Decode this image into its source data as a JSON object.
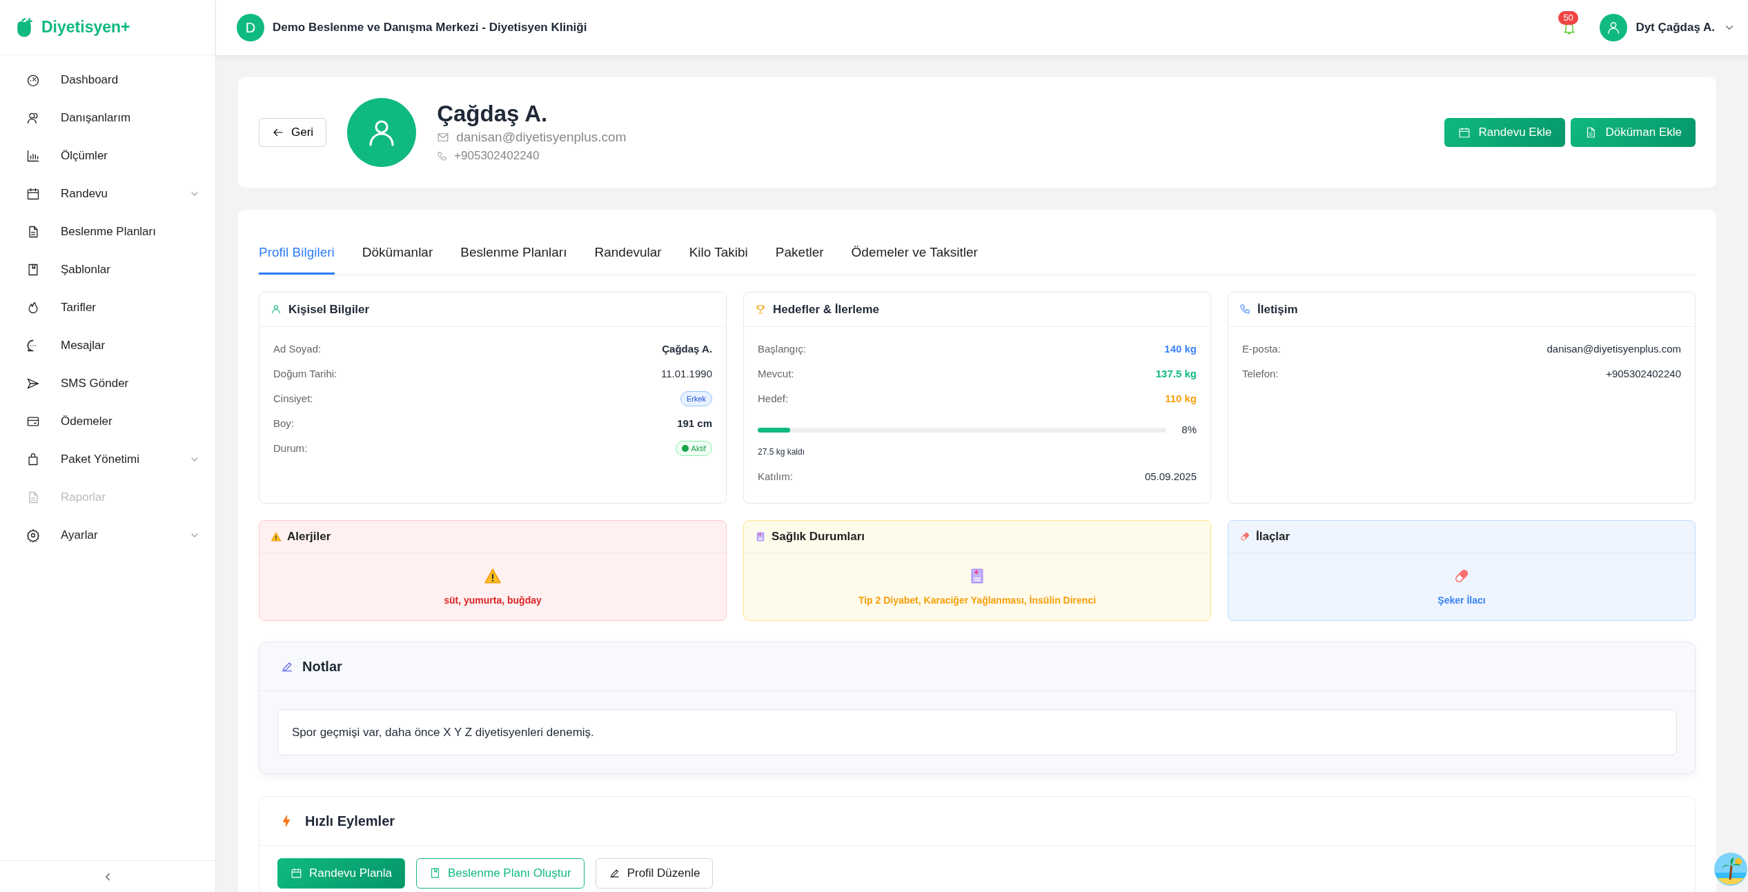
{
  "sidebar": {
    "brand": "Diyetisyen+",
    "items": [
      {
        "label": "Dashboard",
        "expandable": false,
        "disabled": false
      },
      {
        "label": "Danışanlarım",
        "expandable": false,
        "disabled": false
      },
      {
        "label": "Ölçümler",
        "expandable": false,
        "disabled": false
      },
      {
        "label": "Randevu",
        "expandable": true,
        "disabled": false
      },
      {
        "label": "Beslenme Planları",
        "expandable": false,
        "disabled": false
      },
      {
        "label": "Şablonlar",
        "expandable": false,
        "disabled": false
      },
      {
        "label": "Tarifler",
        "expandable": false,
        "disabled": false
      },
      {
        "label": "Mesajlar",
        "expandable": false,
        "disabled": false
      },
      {
        "label": "SMS Gönder",
        "expandable": false,
        "disabled": false
      },
      {
        "label": "Ödemeler",
        "expandable": false,
        "disabled": false
      },
      {
        "label": "Paket Yönetimi",
        "expandable": true,
        "disabled": false
      },
      {
        "label": "Raporlar",
        "expandable": false,
        "disabled": true
      },
      {
        "label": "Ayarlar",
        "expandable": true,
        "disabled": false
      }
    ]
  },
  "header": {
    "org_initial": "D",
    "org_title": "Demo Beslenme ve Danışma Merkezi - Diyetisyen Kliniği",
    "notification_count": "50",
    "user_name": "Dyt Çağdaş A."
  },
  "profile": {
    "back_label": "Geri",
    "name": "Çağdaş A.",
    "email": "danisan@diyetisyenplus.com",
    "phone": "+905302402240",
    "actions": [
      "Randevu Ekle",
      "Döküman Ekle"
    ]
  },
  "tabs": [
    {
      "label": "Profil Bilgileri",
      "selected": true
    },
    {
      "label": "Dökümanlar",
      "selected": false
    },
    {
      "label": "Beslenme Planları",
      "selected": false
    },
    {
      "label": "Randevular",
      "selected": false
    },
    {
      "label": "Kilo Takibi",
      "selected": false
    },
    {
      "label": "Paketler",
      "selected": false
    },
    {
      "label": "Ödemeler ve Taksitler",
      "selected": false
    }
  ],
  "personal": {
    "title": "Kişisel Bilgiler",
    "rows": [
      {
        "label": "Ad Soyad:",
        "value": "Çağdaş A.",
        "kind": "bold"
      },
      {
        "label": "Doğum Tarihi:",
        "value": "11.01.1990",
        "kind": "plain"
      },
      {
        "label": "Cinsiyet:",
        "value": "Erkek",
        "kind": "badge"
      },
      {
        "label": "Boy:",
        "value": "191 cm",
        "kind": "bold"
      },
      {
        "label": "Durum:",
        "value": "Aktif",
        "kind": "status"
      }
    ]
  },
  "goals": {
    "title": "Hedefler & İlerleme",
    "rows": [
      {
        "label": "Başlangıç:",
        "value": "140 kg",
        "color": "#3b82f6"
      },
      {
        "label": "Mevcut:",
        "value": "137.5 kg",
        "color": "#10b981"
      },
      {
        "label": "Hedef:",
        "value": "110 kg",
        "color": "#f59e0b"
      }
    ],
    "progress": {
      "level": 0.08,
      "reading": "8%",
      "remaining": "27.5 kg kaldı"
    },
    "joined": {
      "label": "Katılım:",
      "value": "05.09.2025"
    }
  },
  "contact": {
    "title": "İletişim",
    "rows": [
      {
        "label": "E-posta:",
        "value": "danisan@diyetisyenplus.com"
      },
      {
        "label": "Telefon:",
        "value": "+905302402240"
      }
    ]
  },
  "health": [
    {
      "kind": "allergy",
      "title": "Alerjiler",
      "text": "süt, yumurta, buğday"
    },
    {
      "kind": "condition",
      "title": "Sağlık Durumları",
      "text": "Tip 2 Diyabet, Karaciğer Yağlanması, İnsülin Direnci"
    },
    {
      "kind": "medication",
      "title": "İlaçlar",
      "text": "Şeker İlacı"
    }
  ],
  "notes": {
    "title": "Notlar",
    "text": "Spor geçmişi var, daha önce X Y Z diyetisyenleri denemiş."
  },
  "quick_actions": {
    "title": "Hızlı Eylemler",
    "buttons": [
      {
        "label": "Randevu Planla",
        "kind": "primary"
      },
      {
        "label": "Beslenme Planı Oluştur",
        "kind": "outline"
      },
      {
        "label": "Profil Düzenle",
        "kind": "plain"
      }
    ]
  }
}
